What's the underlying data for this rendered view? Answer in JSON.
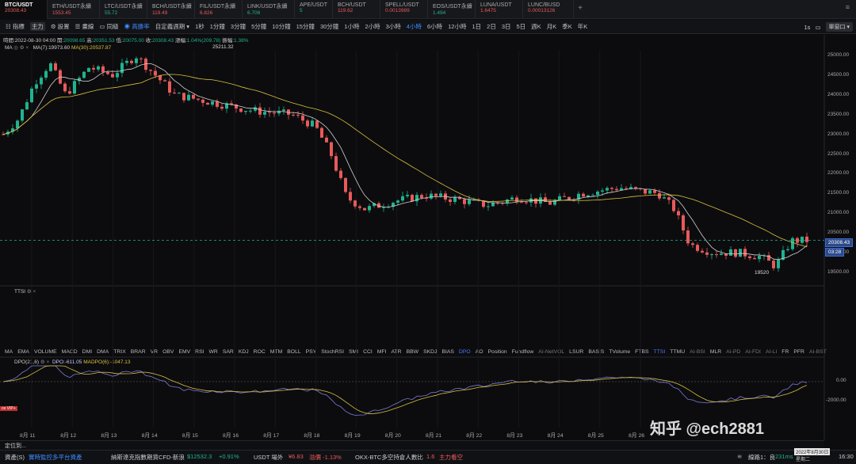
{
  "tabs": [
    {
      "name": "BTC/USDT",
      "price": "20308.43",
      "dir": "red",
      "active": true
    },
    {
      "name": "ETH/USDT永續",
      "price": "1553.45",
      "dir": "red"
    },
    {
      "name": "LTC/USDT永續",
      "price": "55.72",
      "dir": "green"
    },
    {
      "name": "BCH/USDT永續",
      "price": "119.49",
      "dir": "red"
    },
    {
      "name": "FIL/USDT永續",
      "price": "6.826",
      "dir": "red"
    },
    {
      "name": "LINK/USDT永續",
      "price": "6.706",
      "dir": "green"
    },
    {
      "name": "APE/USDT",
      "price": "5",
      "dir": "green"
    },
    {
      "name": "BCH/USDT",
      "price": "119.62",
      "dir": "red"
    },
    {
      "name": "SPELL/USDT",
      "price": "0.0013989",
      "dir": "red"
    },
    {
      "name": "EOS/USDT永續",
      "price": "1.494",
      "dir": "green"
    },
    {
      "name": "LUNA/USDT",
      "price": "1.6475",
      "dir": "red"
    },
    {
      "name": "LUNC/BUSD",
      "price": "0.00013126",
      "dir": "red"
    }
  ],
  "tab_plus": "+",
  "tab_more": "≡",
  "toolbar": {
    "items": [
      {
        "label": "☷ 指標"
      },
      {
        "label": "主力",
        "box": true
      },
      {
        "label": "⚙ 設置"
      },
      {
        "label": "☰ 畫線"
      },
      {
        "label": "▭ 同級"
      },
      {
        "label": "◉ 高勝率",
        "hl": true
      },
      {
        "label": "自定義週期 ▾"
      },
      {
        "label": "1秒"
      },
      {
        "label": "1分鐘"
      },
      {
        "label": "3分鐘"
      },
      {
        "label": "5分鐘"
      },
      {
        "label": "10分鐘"
      },
      {
        "label": "15分鐘"
      },
      {
        "label": "30分鐘"
      },
      {
        "label": "1小時"
      },
      {
        "label": "2小時"
      },
      {
        "label": "3小時"
      },
      {
        "label": "4小時",
        "hl": true
      },
      {
        "label": "6小時"
      },
      {
        "label": "12小時"
      },
      {
        "label": "1日"
      },
      {
        "label": "2日"
      },
      {
        "label": "3日"
      },
      {
        "label": "5日"
      },
      {
        "label": "週K"
      },
      {
        "label": "月K"
      },
      {
        "label": "季K"
      },
      {
        "label": "年K"
      }
    ],
    "right_speed": "1s",
    "right_window": "單窗口 ▾"
  },
  "ohlc": {
    "time": "時間:2022-08-30 04:00",
    "open_l": "開:",
    "open": "20098.65",
    "high_l": "高:",
    "high": "20351.53",
    "low_l": "低:",
    "low": "20075.00",
    "close_l": "收:",
    "close": "20308.43",
    "change_l": "漲幅:",
    "change": "1.04%(209.78)",
    "amp_l": "振幅:",
    "amp": "1.38%"
  },
  "ma": {
    "name": "MA",
    "ma7": "MA(7):19973.60",
    "ma30": "MA(30):20537.87",
    "ma7_color": "#d0d0d0",
    "ma30_color": "#d8c040"
  },
  "ttsi_label": "TTSI",
  "dpo": {
    "name": "DPO(21,6)",
    "dpo": "DPO:-611.05",
    "madpo": "MADPO(6):-1047.13"
  },
  "indicators": [
    "MA",
    "EMA",
    "VOLUME",
    "MACD",
    "DMI",
    "DMA",
    "TRIX",
    "BRAR",
    "VR",
    "OBV",
    "EMV",
    "RSI",
    "WR",
    "SAR",
    "KDJ",
    "ROC",
    "MTM",
    "BOLL",
    "PSY",
    "StochRSI",
    "SMI",
    "CCI",
    "MFI",
    "ATR",
    "BBW",
    "SKDJ",
    "BIAS",
    "DPO",
    "AO",
    "Position",
    "Fundflow",
    "AI-NetVOL",
    "LSUR",
    "BASIS",
    "TVolume",
    "FTBS",
    "TTSI",
    "TTMU",
    "AI-BSI",
    "MLR",
    "AI-PD",
    "AI-FDI",
    "AI-LI",
    "FR",
    "PFR",
    "AI-BST"
  ],
  "active_indicators": [
    "DPO",
    "TTSI"
  ],
  "dim_indicators": [
    "DPO",
    "AI-NetVOL",
    "AI-BSI",
    "AI-PD",
    "AI-FDI",
    "AI-LI",
    "AI-BST"
  ],
  "price_axis": [
    "25000.00",
    "24500.00",
    "24000.00",
    "23500.00",
    "23000.00",
    "22500.00",
    "22000.00",
    "21500.00",
    "21000.00",
    "20500.00",
    "20000.00",
    "19500.00"
  ],
  "dpo_axis": [
    "0.00",
    "-2000.00"
  ],
  "last_price": "20308.43",
  "countdown": "03:28",
  "high_mark": "25211.32",
  "low_mark": "19520",
  "x_labels": [
    "8月 11",
    "8月 12",
    "8月 13",
    "8月 14",
    "8月 15",
    "8月 16",
    "8月 17",
    "8月 18",
    "8月 19",
    "8月 20",
    "8月 21",
    "8月 22",
    "8月 23",
    "8月 24",
    "8月 25",
    "8月 26"
  ],
  "vip_tag": "ce VIP+",
  "location_label": "定位到...",
  "status": {
    "asset": "資產(S)",
    "monitor": "實時監控多平台資產",
    "news": "納斯達克指數期貨CFD-新浪",
    "nas_val": "$12532.3",
    "nas_chg": "+0.91%",
    "usdt": "USDT 場外",
    "usdt_val": "¥6.83",
    "premium": "溢價 -1.13%",
    "okx": "OKX-BTC多空持倉人數比",
    "okx_val": "1.6",
    "okx_note": "主力看空",
    "line": "線路1：良",
    "ms": "231ms",
    "date": "2022年8月30日",
    "weekday": "星期二",
    "time": "16:30"
  },
  "watermark": "知乎 @ech2881",
  "colors": {
    "up": "#1fb38f",
    "down": "#e85a5a",
    "ma7": "#d0d0d0",
    "ma30": "#d8c040",
    "dpo": "#7b7bd8",
    "madpo": "#d8c040",
    "accent": "#3d8bff"
  },
  "icons": [
    "eye-icon",
    "gear-icon",
    "close-icon",
    "plus-icon",
    "menu-icon",
    "wifi-icon"
  ]
}
